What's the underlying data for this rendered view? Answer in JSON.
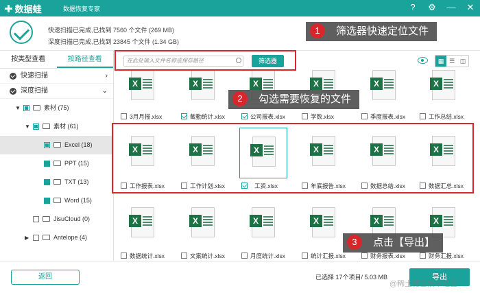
{
  "app": {
    "name": "数据蛙",
    "subtitle": "数据恢复专家",
    "controls": {
      "help": "?",
      "settings": "⚙",
      "minimize": "—",
      "close": "✕"
    }
  },
  "status": {
    "quick_scan": "快速扫描已完成,已找到 7560 个文件 (269 MB)",
    "deep_scan": "深度扫描已完成,已找到 23845 个文件 (1.34 GB)"
  },
  "sidebar": {
    "tabs": [
      {
        "label": "按类型查看",
        "active": false
      },
      {
        "label": "按路径查看",
        "active": true
      }
    ],
    "scans": [
      {
        "label": "快速扫描"
      },
      {
        "label": "深度扫描"
      }
    ],
    "tree": [
      {
        "label": "素材 (75)"
      },
      {
        "label": "素材 (61)"
      },
      {
        "label": "Excel (18)"
      },
      {
        "label": "PPT (15)"
      },
      {
        "label": "TXT (13)"
      },
      {
        "label": "Word (15)"
      },
      {
        "label": "JisuCloud (0)"
      },
      {
        "label": "Antelope (4)"
      }
    ]
  },
  "search": {
    "placeholder": "在此处输入文件名称或保存路径",
    "filter_label": "筛选器"
  },
  "view_modes": {
    "grid": "▦",
    "list": "☰",
    "detail": "◫"
  },
  "files": {
    "row1": [
      {
        "name": "3月月报.xlsx",
        "checked": false
      },
      {
        "name": "截勤统计.xlsx",
        "checked": true
      },
      {
        "name": "公司报表.xlsx",
        "checked": true
      },
      {
        "name": "学数.xlsx",
        "checked": false
      },
      {
        "name": "季度报表.xlsx",
        "checked": false
      },
      {
        "name": "工作总结.xlsx",
        "checked": false
      }
    ],
    "row2": [
      {
        "name": "工作报表.xlsx",
        "checked": false
      },
      {
        "name": "工作计划.xlsx",
        "checked": false
      },
      {
        "name": "工资.xlsx",
        "checked": true
      },
      {
        "name": "年底报告.xlsx",
        "checked": false
      },
      {
        "name": "数据总结.xlsx",
        "checked": false
      },
      {
        "name": "数据汇总.xlsx",
        "checked": false
      }
    ],
    "row3": [
      {
        "name": "数据统计.xlsx",
        "checked": false
      },
      {
        "name": "文案统计.xlsx",
        "checked": false
      },
      {
        "name": "月度统计.xlsx",
        "checked": false
      },
      {
        "name": "统计汇报.xlsx",
        "checked": false
      },
      {
        "name": "财务报表.xlsx",
        "checked": false
      },
      {
        "name": "财务汇报.xlsx",
        "checked": false
      }
    ]
  },
  "callouts": [
    {
      "num": "1",
      "text": "筛选器快速定位文件"
    },
    {
      "num": "2",
      "text": "勾选需要恢复的文件"
    },
    {
      "num": "3",
      "text": "点击【导出】"
    }
  ],
  "footer": {
    "back_label": "返回",
    "selection_info": "已选择 17个项目/ 5.03 MB",
    "export_label": "导出"
  },
  "watermark": "@稀土掘金技术社区",
  "colors": {
    "accent": "#1aa39a",
    "highlight": "#d9262c",
    "excel": "#1e7145"
  }
}
